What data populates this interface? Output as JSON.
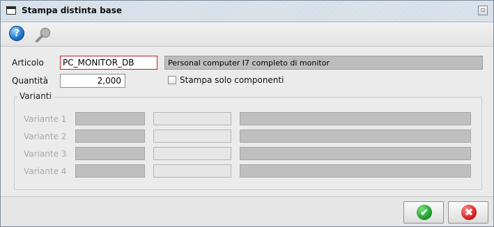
{
  "window": {
    "title": "Stampa distinta base"
  },
  "toolbar": {
    "help_icon": "help-icon",
    "search_icon": "search-icon",
    "help_glyph": "?"
  },
  "form": {
    "articolo_label": "Articolo",
    "articolo_value": "PC_MONITOR_DB",
    "articolo_description": "Personal computer I7 completo di monitor",
    "quantita_label": "Quantità",
    "quantita_value": "2,000",
    "stampa_solo_componenti_label": "Stampa solo componenti",
    "stampa_solo_componenti_checked": false
  },
  "varianti": {
    "legend": "Varianti",
    "rows": [
      {
        "label": "Variante 1"
      },
      {
        "label": "Variante 2"
      },
      {
        "label": "Variante 3"
      },
      {
        "label": "Variante 4"
      }
    ]
  },
  "buttons": {
    "ok_icon": "check-icon",
    "cancel_icon": "x-icon",
    "ok_glyph": "✔",
    "cancel_glyph": "✖"
  },
  "colors": {
    "error_border": "#c41a1a",
    "ok_green": "#1c9b2a",
    "cancel_red": "#d51d1d",
    "help_blue": "#1e73c8"
  }
}
